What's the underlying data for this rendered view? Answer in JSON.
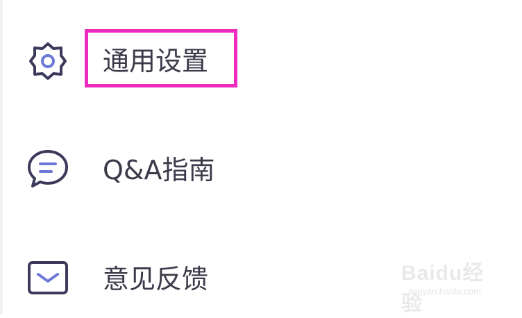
{
  "menu": {
    "items": [
      {
        "label": "通用设置",
        "icon": "gear-icon",
        "highlighted": true
      },
      {
        "label": "Q&A指南",
        "icon": "chat-bubble-icon",
        "highlighted": false
      },
      {
        "label": "意见反馈",
        "icon": "mail-icon",
        "highlighted": false
      }
    ]
  },
  "colors": {
    "icon_stroke": "#3b3a5a",
    "icon_accent": "#6e78d6",
    "text": "#3a3a4a",
    "highlight_border": "#ee2bbf"
  },
  "watermark": {
    "brand": "Baidu经验",
    "url": "jingyan.baidu.com"
  }
}
